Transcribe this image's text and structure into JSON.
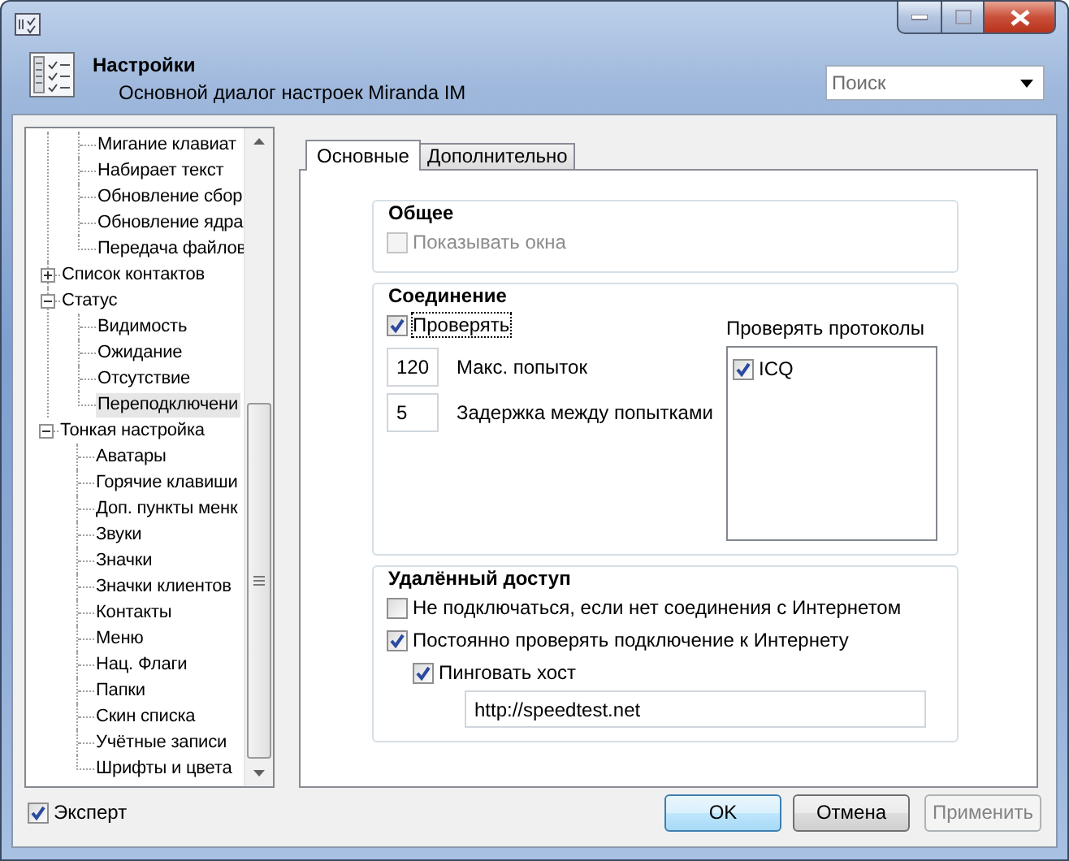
{
  "header": {
    "title": "Настройки",
    "subtitle": "Основной диалог настроек Miranda IM"
  },
  "search": {
    "placeholder": "Поиск"
  },
  "tree": {
    "items": [
      {
        "children": [
          {
            "label": "Мигание клавиат",
            "selected": false
          },
          {
            "label": "Набирает текст",
            "selected": false
          },
          {
            "label": "Обновление сбор",
            "selected": false
          },
          {
            "label": "Обновление ядра",
            "selected": false
          },
          {
            "label": "Передача файлов",
            "selected": false
          }
        ]
      },
      {
        "label": "Список контактов",
        "selected": false,
        "expanded": false
      },
      {
        "label": "Статус",
        "selected": false,
        "expanded": true,
        "children": [
          {
            "label": "Видимость",
            "selected": false
          },
          {
            "label": "Ожидание",
            "selected": false
          },
          {
            "label": "Отсутствие",
            "selected": false
          },
          {
            "label": "Переподключени",
            "selected": true
          }
        ]
      },
      {
        "label": "Тонкая настройка",
        "selected": false,
        "expanded": true,
        "children": [
          {
            "label": "Аватары",
            "selected": false
          },
          {
            "label": "Горячие клавиши",
            "selected": false
          },
          {
            "label": "Доп. пункты менк",
            "selected": false
          },
          {
            "label": "Звуки",
            "selected": false
          },
          {
            "label": "Значки",
            "selected": false
          },
          {
            "label": "Значки клиентов",
            "selected": false
          },
          {
            "label": "Контакты",
            "selected": false
          },
          {
            "label": "Меню",
            "selected": false
          },
          {
            "label": "Нац. Флаги",
            "selected": false
          },
          {
            "label": "Папки",
            "selected": false
          },
          {
            "label": "Скин списка",
            "selected": false
          },
          {
            "label": "Учётные записи",
            "selected": false
          },
          {
            "label": "Шрифты и цвета",
            "selected": false
          }
        ]
      }
    ]
  },
  "expert": {
    "label": "Эксперт",
    "checked": true
  },
  "tabs": [
    {
      "label": "Основные",
      "selected": true
    },
    {
      "label": "Дополнительно",
      "selected": false
    }
  ],
  "groups": [
    {
      "title": "Общее",
      "controls": [
        {
          "kind": "checkbox",
          "label": "Показывать окна",
          "checked": false,
          "disabled": true
        }
      ]
    },
    {
      "title": "Соединение",
      "controls": [
        {
          "kind": "checkbox",
          "label": "Проверять",
          "checked": true,
          "focused": true
        },
        {
          "kind": "number",
          "value": "120",
          "label": "Макс. попыток"
        },
        {
          "kind": "number",
          "value": "5",
          "label": "Задержка между попытками"
        }
      ],
      "protocols": {
        "title": "Проверять протоколы",
        "items": [
          {
            "label": "ICQ",
            "checked": true
          }
        ]
      }
    },
    {
      "title": "Удалённый доступ",
      "controls": [
        {
          "kind": "checkbox",
          "label": "Не подключаться, если нет соединения с Интернетом",
          "checked": false
        },
        {
          "kind": "checkbox",
          "label": "Постоянно проверять подключение к Интернету",
          "checked": true,
          "children": [
            {
              "kind": "checkbox",
              "label": "Пинговать хост",
              "checked": true,
              "children": [
                {
                  "kind": "text",
                  "value": "http://speedtest.net"
                }
              ]
            }
          ]
        }
      ]
    }
  ],
  "buttons": [
    {
      "label": "OK",
      "default": true,
      "disabled": false
    },
    {
      "label": "Отмена",
      "default": false,
      "disabled": false
    },
    {
      "label": "Применить",
      "default": false,
      "disabled": true
    }
  ]
}
